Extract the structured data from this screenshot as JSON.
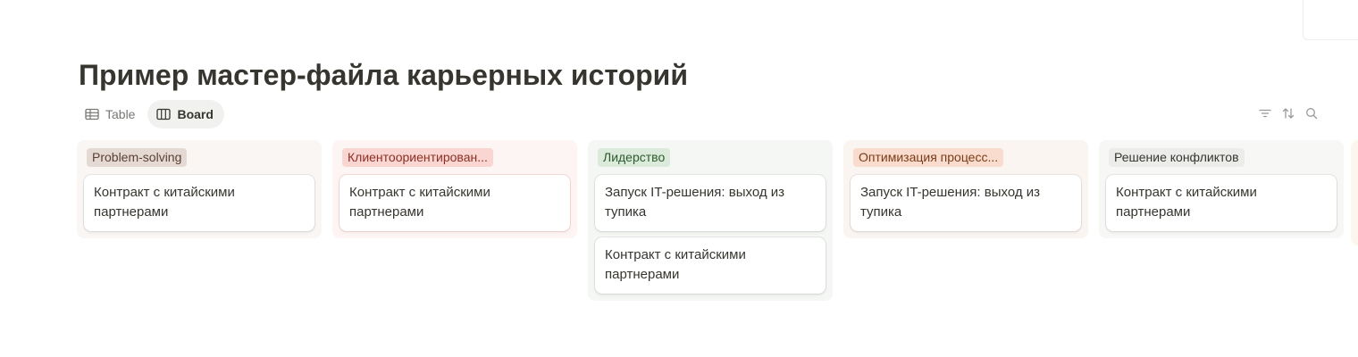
{
  "page": {
    "title": "Пример мастер-файла карьерных историй"
  },
  "views": [
    {
      "label": "Table",
      "icon": "table-icon",
      "active": false
    },
    {
      "label": "Board",
      "icon": "board-icon",
      "active": true
    }
  ],
  "toolbar": {
    "icons": [
      "filter-icon",
      "sort-icon",
      "search-icon"
    ]
  },
  "board": {
    "columns": [
      {
        "label": "Problem-solving",
        "color": "#e5d9d3",
        "cards": [
          "Контракт с китайскими партнерами"
        ]
      },
      {
        "label": "Клиентоориентирован...",
        "color": "#f9d6d1",
        "cards": [
          "Контракт с китайскими партнерами"
        ]
      },
      {
        "label": "Лидерство",
        "color": "#dbeadb",
        "cards": [
          "Запуск IT-решения: выход из тупика",
          "Контракт с китайскими партнерами"
        ]
      },
      {
        "label": "Оптимизация процесс...",
        "color": "#f9dccd",
        "cards": [
          "Запуск IT-решения: выход из тупика"
        ]
      },
      {
        "label": "Решение конфликтов",
        "color": "#ececea",
        "cards": [
          "Контракт с китайскими партнерами"
        ]
      }
    ]
  }
}
